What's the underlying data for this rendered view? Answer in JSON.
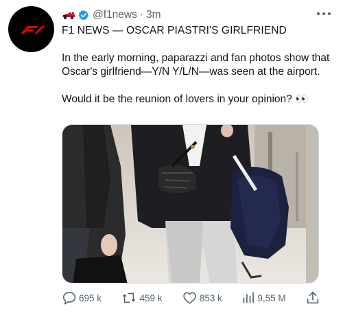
{
  "tweet": {
    "handle": "@f1news",
    "separator": "·",
    "time": "3m",
    "title": "F1 NEWS — OSCAR PIASTRI'S GIRLFRIEND",
    "paragraph": "In the early morning, paparazzi and fan photos show that Oscar's girlfriend—Y/N Y/L/N—was seen at the airport.",
    "question": "Would it be the reunion of lovers in your opinion? 👀",
    "avatar_logo": "F1",
    "icons": {
      "car": "race-car-icon",
      "verified": "verified-badge-icon",
      "more": "more-options-icon"
    },
    "colors": {
      "verified": "#1d9bf0",
      "f1_red": "#e10600",
      "text": "#0f1419",
      "secondary": "#536471"
    }
  },
  "actions": {
    "replies": "695 k",
    "retweets": "459 k",
    "likes": "853 k",
    "views": "9,55 M"
  }
}
